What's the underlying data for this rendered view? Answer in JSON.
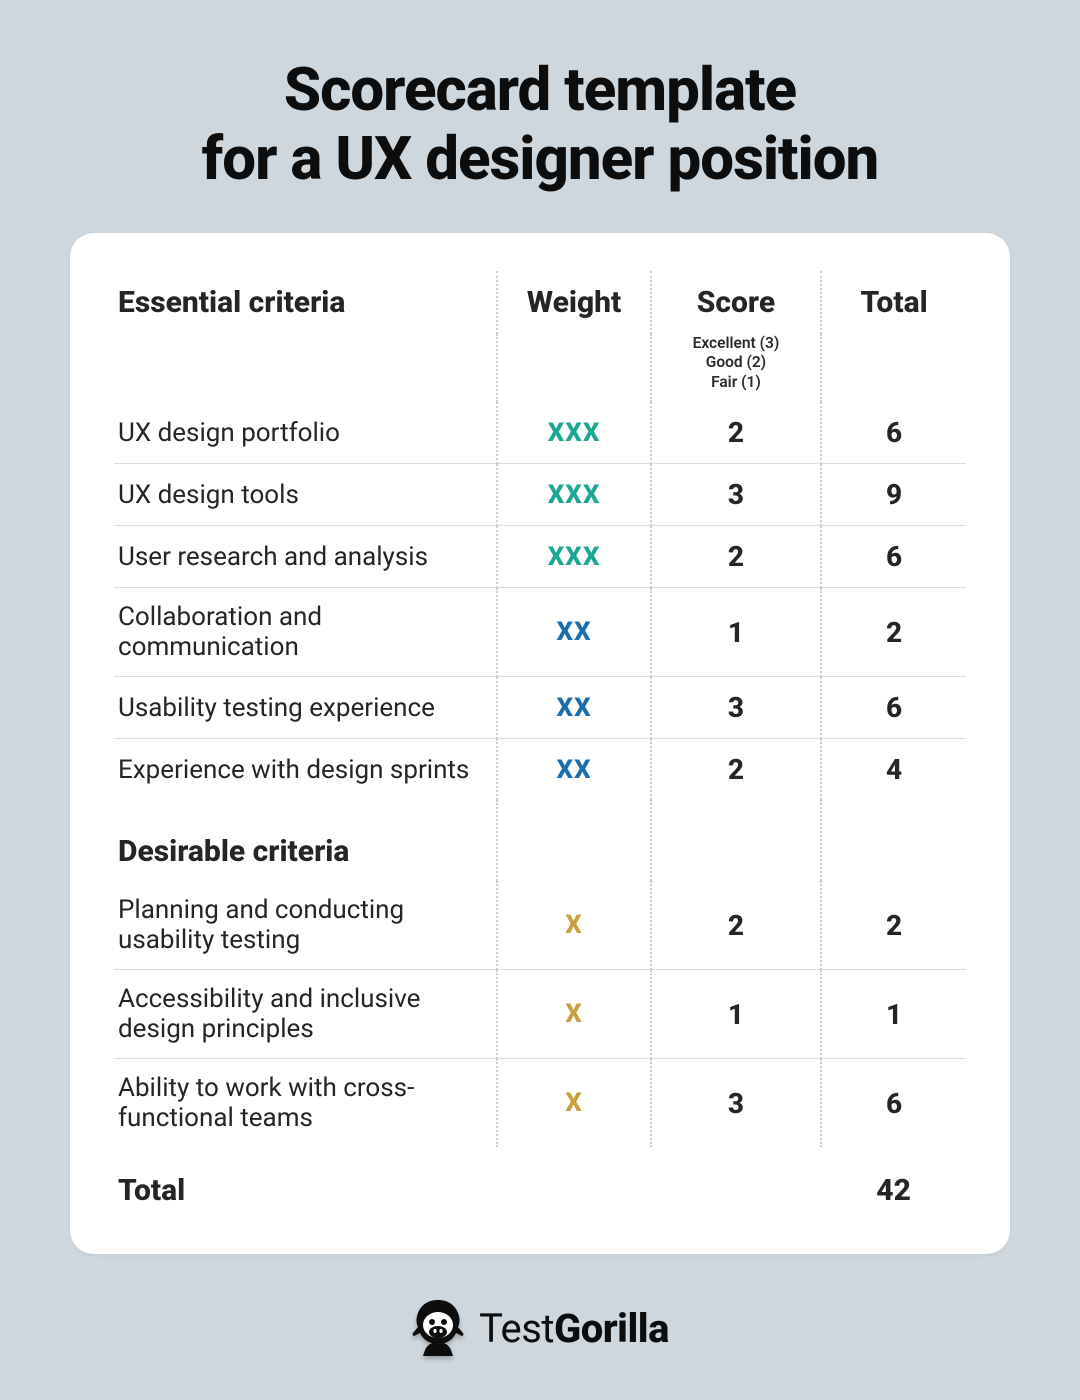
{
  "title_line1": "Scorecard template",
  "title_line2": "for a UX designer position",
  "headers": {
    "criteria": "Essential criteria",
    "weight": "Weight",
    "score": "Score",
    "total": "Total"
  },
  "score_legend": {
    "l1": "Excellent (3)",
    "l2": "Good (2)",
    "l3": "Fair (1)"
  },
  "essential_rows": [
    {
      "criteria": "UX design portfolio",
      "weight": "XXX",
      "wclass": "w-essential",
      "score": "2",
      "total": "6"
    },
    {
      "criteria": "UX design tools",
      "weight": "XXX",
      "wclass": "w-essential",
      "score": "3",
      "total": "9"
    },
    {
      "criteria": "User research and analysis",
      "weight": "XXX",
      "wclass": "w-essential",
      "score": "2",
      "total": "6"
    },
    {
      "criteria": "Collaboration and communication",
      "weight": "XX",
      "wclass": "w-important",
      "score": "1",
      "total": "2"
    },
    {
      "criteria": "Usability testing experience",
      "weight": "XX",
      "wclass": "w-important",
      "score": "3",
      "total": "6"
    },
    {
      "criteria": "Experience with design sprints",
      "weight": "XX",
      "wclass": "w-important",
      "score": "2",
      "total": "4"
    }
  ],
  "desirable_header": "Desirable criteria",
  "desirable_rows": [
    {
      "criteria": "Planning and conducting usability testing",
      "weight": "X",
      "wclass": "w-desirable",
      "score": "2",
      "total": "2"
    },
    {
      "criteria": "Accessibility and inclusive design principles",
      "weight": "X",
      "wclass": "w-desirable",
      "score": "1",
      "total": "1"
    },
    {
      "criteria": "Ability to work with cross-functional teams",
      "weight": "X",
      "wclass": "w-desirable",
      "score": "3",
      "total": "6"
    }
  ],
  "grand_total_label": "Total",
  "grand_total_value": "42",
  "brand": {
    "part1": "Test",
    "part2": "Gorilla"
  }
}
